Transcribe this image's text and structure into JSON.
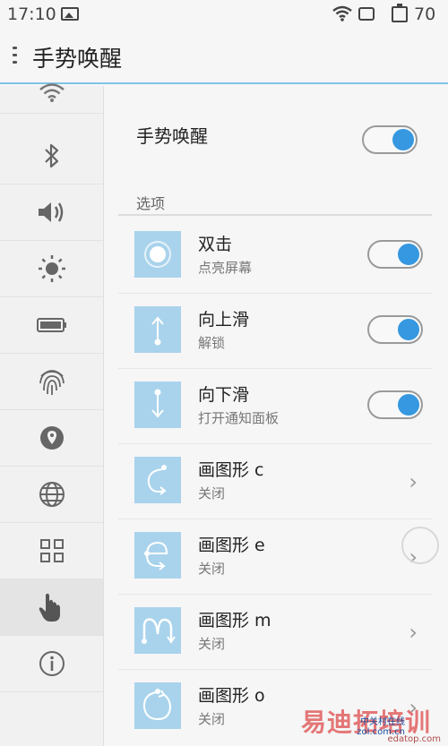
{
  "status_bar": {
    "time": "17:10",
    "battery_percent": "70",
    "icons": [
      "image-icon",
      "wifi-icon",
      "sim-icon",
      "battery-icon"
    ]
  },
  "title_bar": {
    "title": "手势唤醒"
  },
  "sidebar": {
    "items": [
      {
        "icon": "wifi-icon"
      },
      {
        "icon": "bluetooth-icon"
      },
      {
        "icon": "volume-icon"
      },
      {
        "icon": "brightness-icon"
      },
      {
        "icon": "battery-icon"
      },
      {
        "icon": "fingerprint-icon"
      },
      {
        "icon": "location-icon"
      },
      {
        "icon": "globe-icon"
      },
      {
        "icon": "apps-grid-icon"
      },
      {
        "icon": "hand-gesture-icon",
        "active": true
      },
      {
        "icon": "info-icon"
      }
    ]
  },
  "main": {
    "label": "手势唤醒",
    "toggle_on": true,
    "section_label": "选项",
    "options": [
      {
        "title": "双击",
        "subtitle": "点亮屏幕",
        "control": "toggle",
        "on": true,
        "icon": "double-tap-icon"
      },
      {
        "title": "向上滑",
        "subtitle": "解锁",
        "control": "toggle",
        "on": true,
        "icon": "swipe-up-icon"
      },
      {
        "title": "向下滑",
        "subtitle": "打开通知面板",
        "control": "toggle",
        "on": true,
        "icon": "swipe-down-icon"
      },
      {
        "title": "画图形 c",
        "subtitle": "关闭",
        "control": "chevron",
        "icon": "draw-c-icon"
      },
      {
        "title": "画图形 e",
        "subtitle": "关闭",
        "control": "chevron",
        "icon": "draw-e-icon"
      },
      {
        "title": "画图形 m",
        "subtitle": "关闭",
        "control": "chevron",
        "icon": "draw-m-icon"
      },
      {
        "title": "画图形 o",
        "subtitle": "关闭",
        "control": "chevron",
        "icon": "draw-o-icon"
      }
    ],
    "chevron_glyph": "›"
  },
  "watermark": {
    "text": "易迪拓培训",
    "sub1": "中关村在线",
    "sub2": "zol.com.cn",
    "domain": "edatop.com"
  },
  "colors": {
    "accent": "#3598e0",
    "title_underline": "#7fc4e6",
    "option_icon_bg": "#a9d3ec"
  }
}
